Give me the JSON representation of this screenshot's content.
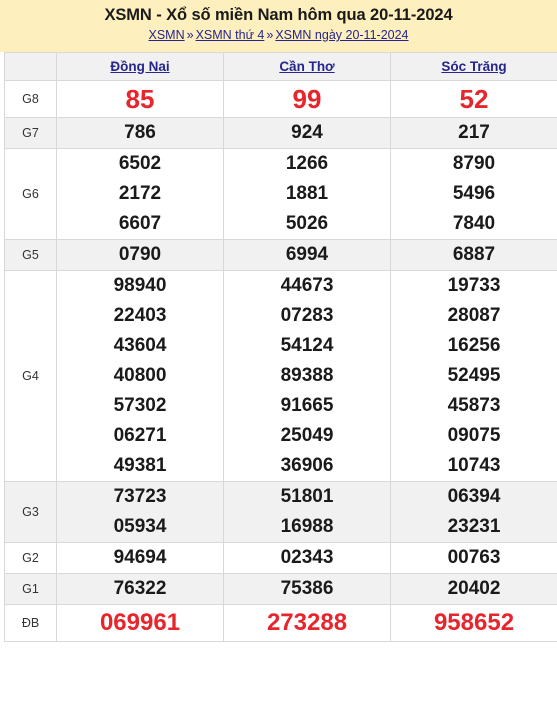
{
  "header": {
    "title": "XSMN - Xổ số miền Nam hôm qua 20-11-2024",
    "breadcrumb": [
      {
        "label": "XSMN"
      },
      {
        "label": "XSMN thứ 4"
      },
      {
        "label": "XSMN ngày 20-11-2024"
      }
    ],
    "separator": "»",
    "background_color": "#fdf0be",
    "link_color": "#25258c"
  },
  "table": {
    "corner_label": "",
    "provinces": [
      "Đồng Nai",
      "Cần Thơ",
      "Sóc Trăng"
    ],
    "highlight_color": "#e8252c",
    "rows": [
      {
        "label": "G8",
        "style": "big-red",
        "shaded": false,
        "values": [
          [
            "85"
          ],
          [
            "99"
          ],
          [
            "52"
          ]
        ]
      },
      {
        "label": "G7",
        "style": "normal",
        "shaded": true,
        "values": [
          [
            "786"
          ],
          [
            "924"
          ],
          [
            "217"
          ]
        ]
      },
      {
        "label": "G6",
        "style": "normal",
        "shaded": false,
        "values": [
          [
            "6502",
            "2172",
            "6607"
          ],
          [
            "1266",
            "1881",
            "5026"
          ],
          [
            "8790",
            "5496",
            "7840"
          ]
        ]
      },
      {
        "label": "G5",
        "style": "normal",
        "shaded": true,
        "values": [
          [
            "0790"
          ],
          [
            "6994"
          ],
          [
            "6887"
          ]
        ]
      },
      {
        "label": "G4",
        "style": "normal",
        "shaded": false,
        "values": [
          [
            "98940",
            "22403",
            "43604",
            "40800",
            "57302",
            "06271",
            "49381"
          ],
          [
            "44673",
            "07283",
            "54124",
            "89388",
            "91665",
            "25049",
            "36906"
          ],
          [
            "19733",
            "28087",
            "16256",
            "52495",
            "45873",
            "09075",
            "10743"
          ]
        ]
      },
      {
        "label": "G3",
        "style": "normal",
        "shaded": true,
        "values": [
          [
            "73723",
            "05934"
          ],
          [
            "51801",
            "16988"
          ],
          [
            "06394",
            "23231"
          ]
        ]
      },
      {
        "label": "G2",
        "style": "normal",
        "shaded": false,
        "values": [
          [
            "94694"
          ],
          [
            "02343"
          ],
          [
            "00763"
          ]
        ]
      },
      {
        "label": "G1",
        "style": "normal",
        "shaded": true,
        "values": [
          [
            "76322"
          ],
          [
            "75386"
          ],
          [
            "20402"
          ]
        ]
      },
      {
        "label": "ĐB",
        "style": "db-red",
        "shaded": false,
        "values": [
          [
            "069961"
          ],
          [
            "273288"
          ],
          [
            "958652"
          ]
        ]
      }
    ]
  }
}
